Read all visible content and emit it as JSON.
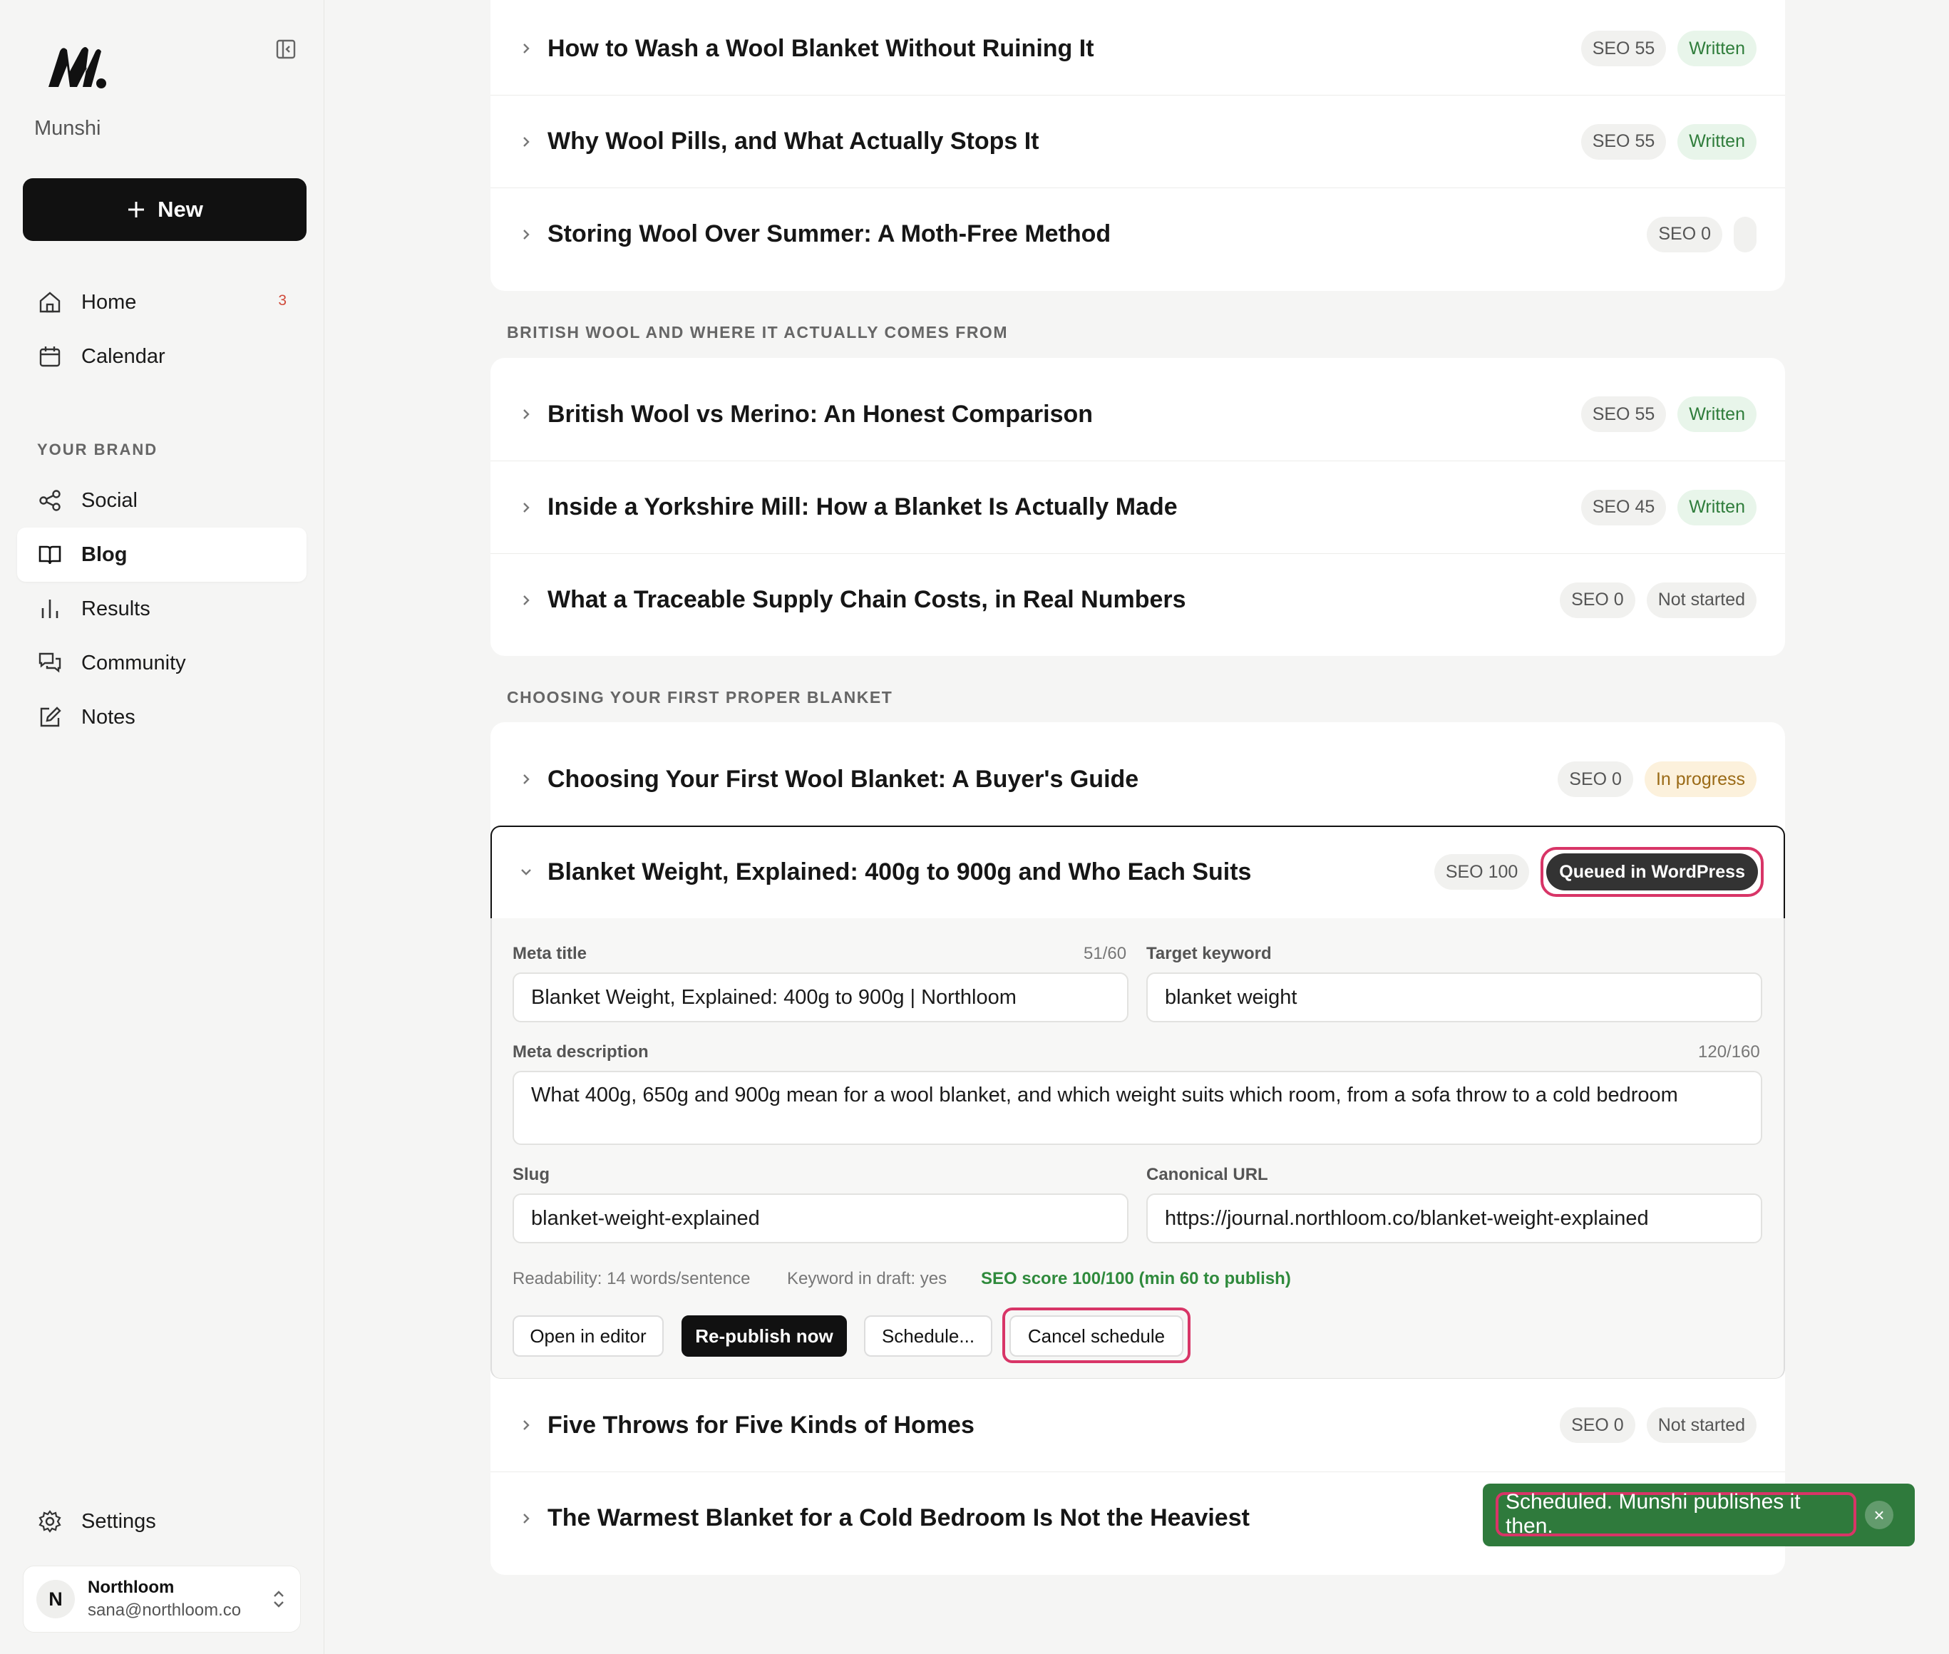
{
  "sidebar": {
    "brand": "Munshi",
    "new_label": "New",
    "nav": [
      {
        "label": "Home",
        "badge": "3"
      },
      {
        "label": "Calendar"
      },
      {
        "label": "Social"
      },
      {
        "label": "Blog"
      },
      {
        "label": "Results"
      },
      {
        "label": "Community"
      },
      {
        "label": "Notes"
      }
    ],
    "section_label": "YOUR BRAND",
    "settings_label": "Settings",
    "account": {
      "initial": "N",
      "name": "Northloom",
      "email": "sana@northloom.co"
    }
  },
  "groups": [
    {
      "label": ""
    },
    {
      "label": "BRITISH WOOL AND WHERE IT ACTUALLY COMES FROM"
    },
    {
      "label": "CHOOSING YOUR FIRST PROPER BLANKET"
    }
  ],
  "posts": [
    {
      "title": "How to Wash a Wool Blanket Without Ruining It",
      "seo": "SEO 55",
      "status": "Written"
    },
    {
      "title": "Why Wool Pills, and What Actually Stops It",
      "seo": "SEO 55",
      "status": "Written"
    },
    {
      "title": "Storing Wool Over Summer: A Moth-Free Method",
      "seo": "SEO 0",
      "status": ""
    },
    {
      "title": "British Wool vs Merino: An Honest Comparison",
      "seo": "SEO 55",
      "status": "Written"
    },
    {
      "title": "Inside a Yorkshire Mill: How a Blanket Is Actually Made",
      "seo": "SEO 45",
      "status": "Written"
    },
    {
      "title": "What a Traceable Supply Chain Costs, in Real Numbers",
      "seo": "SEO 0",
      "status": "Not started"
    },
    {
      "title": "Choosing Your First Wool Blanket: A Buyer's Guide",
      "seo": "SEO 0",
      "status": "In progress"
    },
    {
      "title": "Blanket Weight, Explained: 400g to 900g and Who Each Suits",
      "seo": "SEO 100",
      "status": "Queued in WordPress"
    },
    {
      "title": "Five Throws for Five Kinds of Homes",
      "seo": "SEO 0",
      "status": "Not started"
    },
    {
      "title": "The Warmest Blanket for a Cold Bedroom Is Not the Heaviest",
      "seo": "",
      "status": ""
    }
  ],
  "editor": {
    "meta_title_label": "Meta title",
    "meta_title_count": "51/60",
    "meta_title_value": "Blanket Weight, Explained: 400g to 900g | Northloom",
    "keyword_label": "Target keyword",
    "keyword_value": "blanket weight",
    "meta_desc_label": "Meta description",
    "meta_desc_count": "120/160",
    "meta_desc_value": "What 400g, 650g and 900g mean for a wool blanket, and which weight suits which room, from a sofa throw to a cold bedroom",
    "slug_label": "Slug",
    "slug_value": "blanket-weight-explained",
    "canonical_label": "Canonical URL",
    "canonical_value": "https://journal.northloom.co/blanket-weight-explained",
    "readability": "Readability: 14 words/sentence",
    "keyword_in_draft": "Keyword in draft: yes",
    "seo_score": "SEO score 100/100 (min 60 to publish)",
    "buttons": {
      "open": "Open in editor",
      "republish": "Re-publish now",
      "schedule": "Schedule...",
      "cancel": "Cancel schedule"
    }
  },
  "toast": {
    "message": "Scheduled. Munshi publishes it then.",
    "close": "×"
  },
  "colors": {
    "accent_highlight": "#d83567",
    "written_green": "#2f7d3b",
    "toast_green": "#2f7a3c"
  }
}
